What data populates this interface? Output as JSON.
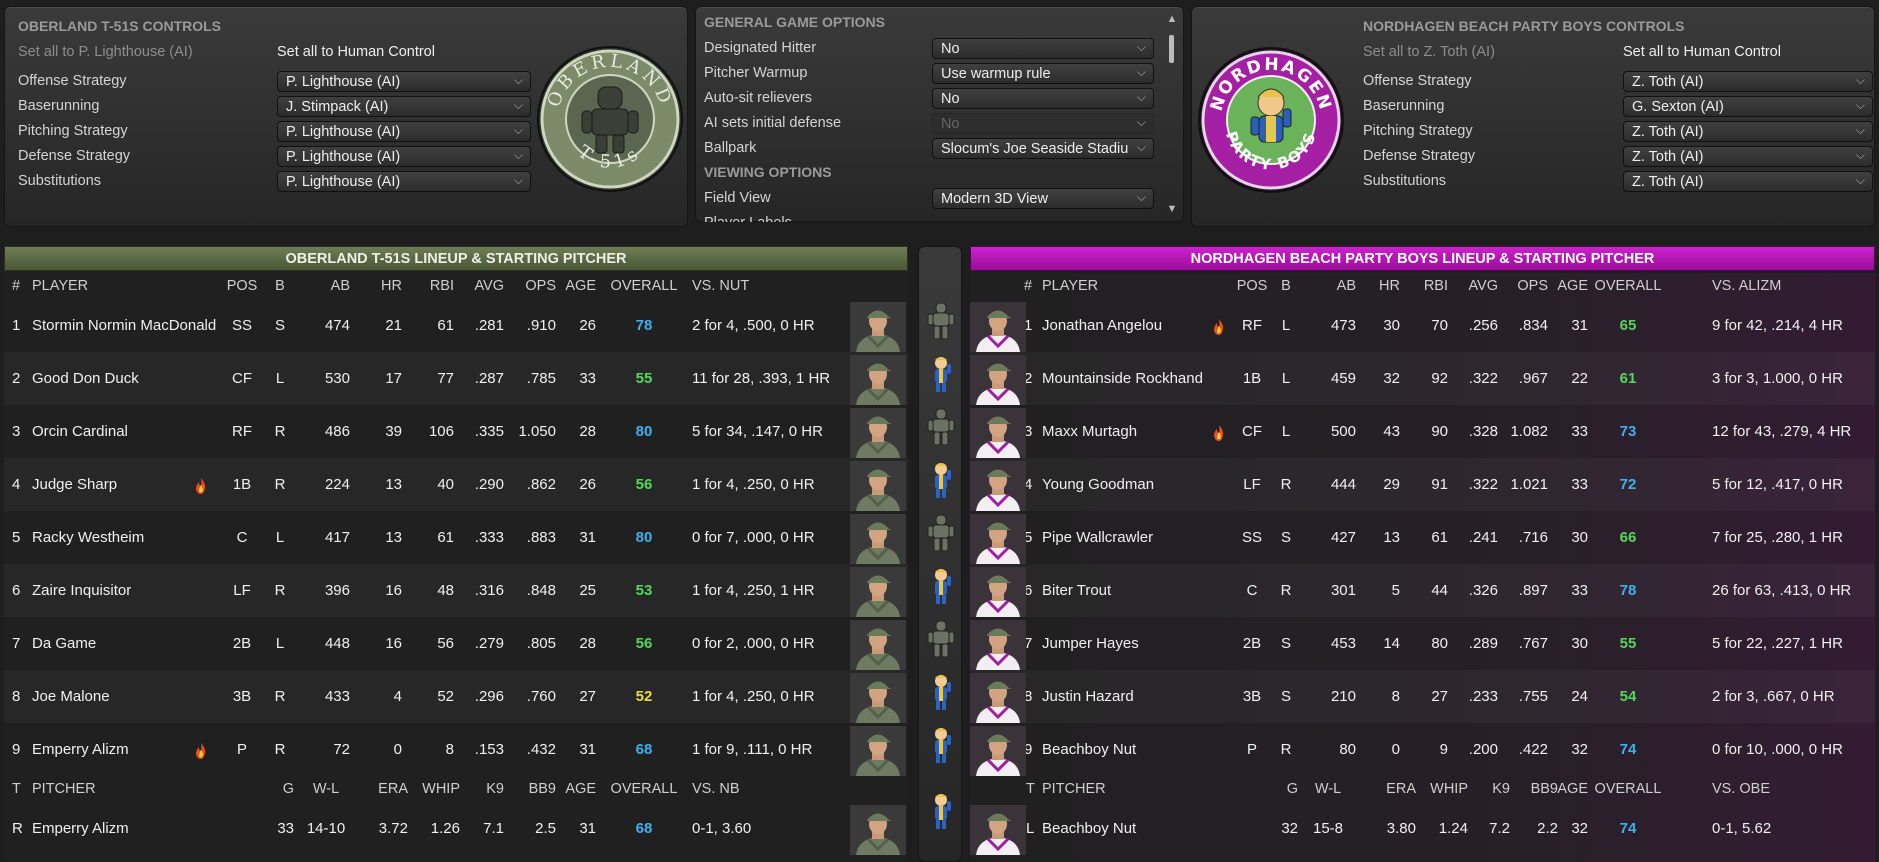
{
  "colors": {
    "green": "#52d85a",
    "blue": "#3fb0ee",
    "yellow": "#e7de3b",
    "away_header": "#5c6a45",
    "home_header": "#b60fb6"
  },
  "away_controls": {
    "title": "OBERLAND T-51S CONTROLS",
    "set_ai": "Set all to P. Lighthouse (AI)",
    "set_human": "Set all to Human Control",
    "rows": [
      {
        "label": "Offense Strategy",
        "value": "P. Lighthouse (AI)"
      },
      {
        "label": "Baserunning",
        "value": "J. Stimpack (AI)"
      },
      {
        "label": "Pitching Strategy",
        "value": "P. Lighthouse (AI)"
      },
      {
        "label": "Defense Strategy",
        "value": "P. Lighthouse (AI)"
      },
      {
        "label": "Substitutions",
        "value": "P. Lighthouse (AI)"
      }
    ],
    "logo_top": "OBERLAND",
    "logo_bottom": "T-51s"
  },
  "general": {
    "title": "GENERAL GAME OPTIONS",
    "rows": [
      {
        "label": "Designated Hitter",
        "value": "No"
      },
      {
        "label": "Pitcher Warmup",
        "value": "Use warmup rule"
      },
      {
        "label": "Auto-sit relievers",
        "value": "No"
      },
      {
        "label": "AI sets initial defense",
        "value": "No"
      },
      {
        "label": "Ballpark",
        "value": "Slocum's Joe Seaside Stadiu"
      }
    ],
    "viewing_title": "VIEWING OPTIONS",
    "field_view_label": "Field View",
    "field_view_value": "Modern 3D View",
    "cut_label": "Player Labels"
  },
  "home_controls": {
    "title": "NORDHAGEN BEACH PARTY BOYS CONTROLS",
    "set_ai": "Set all to Z. Toth (AI)",
    "set_human": "Set all to Human Control",
    "rows": [
      {
        "label": "Offense Strategy",
        "value": "Z. Toth (AI)"
      },
      {
        "label": "Baserunning",
        "value": "G. Sexton (AI)"
      },
      {
        "label": "Pitching Strategy",
        "value": "Z. Toth (AI)"
      },
      {
        "label": "Defense Strategy",
        "value": "Z. Toth (AI)"
      },
      {
        "label": "Substitutions",
        "value": "Z. Toth (AI)"
      }
    ],
    "logo_top": "NORDHAGEN",
    "logo_bottom": "PARTY BOYS"
  },
  "away_lineup": {
    "title": "OBERLAND T-51S LINEUP & STARTING PITCHER",
    "headers": {
      "num": "#",
      "player": "PLAYER",
      "pos": "POS",
      "b": "B",
      "ab": "AB",
      "hr": "HR",
      "rbi": "RBI",
      "avg": "AVG",
      "ops": "OPS",
      "age": "AGE",
      "overall": "OVERALL",
      "vs": "VS. NUT"
    },
    "players": [
      {
        "num": "1",
        "name": "Stormin Normin MacDonald",
        "pos": "SS",
        "b": "S",
        "ab": "474",
        "hr": "21",
        "rbi": "61",
        "avg": ".281",
        "ops": ".910",
        "age": "26",
        "overall": "78",
        "ovc": "blue",
        "vs": "2 for 4, .500, 0 HR",
        "hot": false
      },
      {
        "num": "2",
        "name": "Good Don Duck",
        "pos": "CF",
        "b": "L",
        "ab": "530",
        "hr": "17",
        "rbi": "77",
        "avg": ".287",
        "ops": ".785",
        "age": "33",
        "overall": "55",
        "ovc": "green",
        "vs": "11 for 28, .393, 1 HR",
        "hot": false
      },
      {
        "num": "3",
        "name": "Orcin Cardinal",
        "pos": "RF",
        "b": "R",
        "ab": "486",
        "hr": "39",
        "rbi": "106",
        "avg": ".335",
        "ops": "1.050",
        "age": "28",
        "overall": "80",
        "ovc": "blue",
        "vs": "5 for 34, .147, 0 HR",
        "hot": false
      },
      {
        "num": "4",
        "name": "Judge Sharp",
        "pos": "1B",
        "b": "R",
        "ab": "224",
        "hr": "13",
        "rbi": "40",
        "avg": ".290",
        "ops": ".862",
        "age": "26",
        "overall": "56",
        "ovc": "green",
        "vs": "1 for 4, .250, 0 HR",
        "hot": true
      },
      {
        "num": "5",
        "name": "Racky Westheim",
        "pos": "C",
        "b": "L",
        "ab": "417",
        "hr": "13",
        "rbi": "61",
        "avg": ".333",
        "ops": ".883",
        "age": "31",
        "overall": "80",
        "ovc": "blue",
        "vs": "0 for 7, .000, 0 HR",
        "hot": false
      },
      {
        "num": "6",
        "name": "Zaire Inquisitor",
        "pos": "LF",
        "b": "R",
        "ab": "396",
        "hr": "16",
        "rbi": "48",
        "avg": ".316",
        "ops": ".848",
        "age": "25",
        "overall": "53",
        "ovc": "green",
        "vs": "1 for 4, .250, 1 HR",
        "hot": false
      },
      {
        "num": "7",
        "name": "Da Game",
        "pos": "2B",
        "b": "L",
        "ab": "448",
        "hr": "16",
        "rbi": "56",
        "avg": ".279",
        "ops": ".805",
        "age": "28",
        "overall": "56",
        "ovc": "green",
        "vs": "0 for 2, .000, 0 HR",
        "hot": false
      },
      {
        "num": "8",
        "name": "Joe Malone",
        "pos": "3B",
        "b": "R",
        "ab": "433",
        "hr": "4",
        "rbi": "52",
        "avg": ".296",
        "ops": ".760",
        "age": "27",
        "overall": "52",
        "ovc": "yellow",
        "vs": "1 for 4, .250, 0 HR",
        "hot": false
      },
      {
        "num": "9",
        "name": "Emperry Alizm",
        "pos": "P",
        "b": "R",
        "ab": "72",
        "hr": "0",
        "rbi": "8",
        "avg": ".153",
        "ops": ".432",
        "age": "31",
        "overall": "68",
        "ovc": "blue",
        "vs": "1 for 9, .111, 0 HR",
        "hot": true
      }
    ],
    "pitcher_headers": {
      "t": "T",
      "pitcher": "PITCHER",
      "g": "G",
      "wl": "W-L",
      "era": "ERA",
      "whip": "WHIP",
      "k9": "K9",
      "bb9": "BB9",
      "age": "AGE",
      "overall": "OVERALL",
      "vs": "VS. NB"
    },
    "pitcher": {
      "t": "R",
      "name": "Emperry Alizm",
      "g": "33",
      "wl": "14-10",
      "era": "3.72",
      "whip": "1.26",
      "k9": "7.1",
      "bb9": "2.5",
      "age": "31",
      "overall": "68",
      "vs": "0-1, 3.60"
    }
  },
  "home_lineup": {
    "title": "NORDHAGEN BEACH PARTY BOYS LINEUP & STARTING PITCHER",
    "headers": {
      "num": "#",
      "player": "PLAYER",
      "pos": "POS",
      "b": "B",
      "ab": "AB",
      "hr": "HR",
      "rbi": "RBI",
      "avg": "AVG",
      "ops": "OPS",
      "age": "AGE",
      "overall": "OVERALL",
      "vs": "VS. ALIZM"
    },
    "players": [
      {
        "num": "1",
        "name": "Jonathan Angelou",
        "pos": "RF",
        "b": "L",
        "ab": "473",
        "hr": "30",
        "rbi": "70",
        "avg": ".256",
        "ops": ".834",
        "age": "31",
        "overall": "65",
        "ovc": "green",
        "vs": "9 for 42, .214, 4 HR",
        "hot": true
      },
      {
        "num": "2",
        "name": "Mountainside Rockhand",
        "pos": "1B",
        "b": "L",
        "ab": "459",
        "hr": "32",
        "rbi": "92",
        "avg": ".322",
        "ops": ".967",
        "age": "22",
        "overall": "61",
        "ovc": "green",
        "vs": "3 for 3, 1.000, 0 HR",
        "hot": false
      },
      {
        "num": "3",
        "name": "Maxx Murtagh",
        "pos": "CF",
        "b": "L",
        "ab": "500",
        "hr": "43",
        "rbi": "90",
        "avg": ".328",
        "ops": "1.082",
        "age": "33",
        "overall": "73",
        "ovc": "blue",
        "vs": "12 for 43, .279, 4 HR",
        "hot": true
      },
      {
        "num": "4",
        "name": "Young Goodman",
        "pos": "LF",
        "b": "R",
        "ab": "444",
        "hr": "29",
        "rbi": "91",
        "avg": ".322",
        "ops": "1.021",
        "age": "33",
        "overall": "72",
        "ovc": "blue",
        "vs": "5 for 12, .417, 0 HR",
        "hot": false
      },
      {
        "num": "5",
        "name": "Pipe Wallcrawler",
        "pos": "SS",
        "b": "S",
        "ab": "427",
        "hr": "13",
        "rbi": "61",
        "avg": ".241",
        "ops": ".716",
        "age": "30",
        "overall": "66",
        "ovc": "green",
        "vs": "7 for 25, .280, 1 HR",
        "hot": false
      },
      {
        "num": "6",
        "name": "Biter Trout",
        "pos": "C",
        "b": "R",
        "ab": "301",
        "hr": "5",
        "rbi": "44",
        "avg": ".326",
        "ops": ".897",
        "age": "33",
        "overall": "78",
        "ovc": "blue",
        "vs": "26 for 63, .413, 0 HR",
        "hot": false
      },
      {
        "num": "7",
        "name": "Jumper Hayes",
        "pos": "2B",
        "b": "S",
        "ab": "453",
        "hr": "14",
        "rbi": "80",
        "avg": ".289",
        "ops": ".767",
        "age": "30",
        "overall": "55",
        "ovc": "green",
        "vs": "5 for 22, .227, 1 HR",
        "hot": false
      },
      {
        "num": "8",
        "name": "Justin Hazard",
        "pos": "3B",
        "b": "S",
        "ab": "210",
        "hr": "8",
        "rbi": "27",
        "avg": ".233",
        "ops": ".755",
        "age": "24",
        "overall": "54",
        "ovc": "green",
        "vs": "2 for 3, .667, 0 HR",
        "hot": false
      },
      {
        "num": "9",
        "name": "Beachboy Nut",
        "pos": "P",
        "b": "R",
        "ab": "80",
        "hr": "0",
        "rbi": "9",
        "avg": ".200",
        "ops": ".422",
        "age": "32",
        "overall": "74",
        "ovc": "blue",
        "vs": "0 for 10, .000, 0 HR",
        "hot": false
      }
    ],
    "pitcher_headers": {
      "t": "T",
      "pitcher": "PITCHER",
      "g": "G",
      "wl": "W-L",
      "era": "ERA",
      "whip": "WHIP",
      "k9": "K9",
      "bb9": "BB9",
      "age": "AGE",
      "overall": "OVERALL",
      "vs": "VS. OBE"
    },
    "pitcher": {
      "t": "L",
      "name": "Beachboy Nut",
      "g": "32",
      "wl": "15-8",
      "era": "3.80",
      "whip": "1.24",
      "k9": "7.2",
      "bb9": "2.2",
      "age": "32",
      "overall": "74",
      "vs": "0-1, 5.62"
    }
  },
  "mid_icons": [
    "armor-icon",
    "vaultboy-icon",
    "armor-icon",
    "vaultboy-icon",
    "armor-icon",
    "vaultboy-icon",
    "armor-icon",
    "vaultboy-icon",
    "vaultboy-icon",
    "vaultboy-icon"
  ]
}
